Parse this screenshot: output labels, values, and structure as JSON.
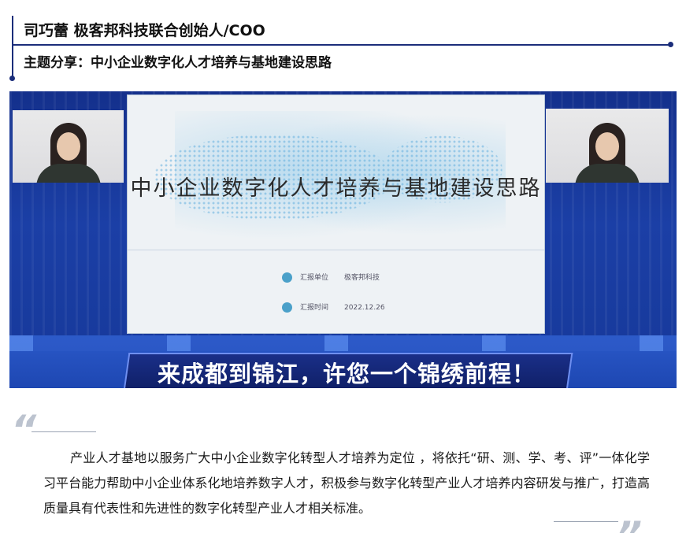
{
  "header": {
    "speaker": "司巧蕾 极客邦科技联合创始人/COO",
    "topic": "主题分享：中小企业数字化人才培养与基地建设思路"
  },
  "video": {
    "slide_title": "中小企业数字化人才培养与基地建设思路",
    "slide_info": [
      {
        "icon": "location-icon",
        "label": "汇报单位",
        "value": "极客邦科技"
      },
      {
        "icon": "clock-icon",
        "label": "汇报时间",
        "value": "2022.12.26"
      }
    ],
    "slogan": "来成都到锦江，许您一个锦绣前程！"
  },
  "quote": {
    "open_mark": "“",
    "close_mark": "”",
    "text": "产业人才基地以服务广大中小企业数字化转型人才培养为定位 ，将依托“研、测、学、考、评”一体化学习平台能力帮助中小企业体系化地培养数字人才，积极参与数字化转型产业人才培养内容研发与推广，打造高质量具有代表性和先进性的数字化转型产业人才相关标准。"
  },
  "colors": {
    "accent_navy": "#1b2d7a",
    "video_blue": "#1b3fa6",
    "quote_mark": "#bcc3cf"
  }
}
